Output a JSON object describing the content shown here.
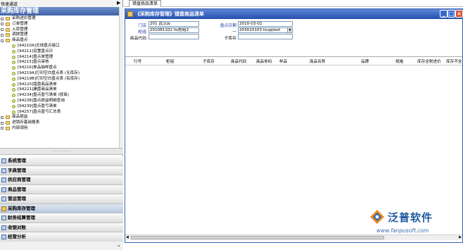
{
  "quick_channel": "快速通道",
  "tabs": [
    {
      "label": "错盘商品清单"
    }
  ],
  "sidebar": {
    "title": "采购库存管理",
    "tree": [
      {
        "label": "采购进价管理",
        "type": "folder",
        "level": 0,
        "expanded": false
      },
      {
        "label": "订单管理",
        "type": "folder",
        "level": 0,
        "expanded": false
      },
      {
        "label": "入库管理",
        "type": "folder",
        "level": 0,
        "expanded": false
      },
      {
        "label": "调拨管理",
        "type": "folder",
        "level": 0,
        "expanded": false
      },
      {
        "label": "商品盘点",
        "type": "folder",
        "level": 0,
        "expanded": true
      },
      {
        "label": "[94210A]无线盘点接口",
        "type": "leaf",
        "level": 1
      },
      {
        "label": "[94211]设置盘点日",
        "type": "leaf",
        "level": 1
      },
      {
        "label": "[94214]盘点单管理",
        "type": "leaf",
        "level": 1
      },
      {
        "label": "[94215]盘点审核",
        "type": "leaf",
        "level": 1
      },
      {
        "label": "[94216]单品抽样盘点",
        "type": "leaf",
        "level": 1
      },
      {
        "label": "[94219A]打印空白盘点表 (无库存)",
        "type": "leaf",
        "level": 1
      },
      {
        "label": "[94219B]打印空白盘点表 (有库存)",
        "type": "leaf",
        "level": 1
      },
      {
        "label": "[94220]错盘商品清单",
        "type": "leaf",
        "level": 1
      },
      {
        "label": "[94221]漏盘商品清单",
        "type": "leaf",
        "level": 1
      },
      {
        "label": "[94234]盘点盈亏清单 (按串)",
        "type": "leaf",
        "level": 1
      },
      {
        "label": "[94238]盘点损益明细查询",
        "type": "leaf",
        "level": 1
      },
      {
        "label": "[94239]盘点盈亏清单",
        "type": "leaf",
        "level": 1
      },
      {
        "label": "[94257]盘点盈亏汇总表",
        "type": "leaf",
        "level": 1
      },
      {
        "label": "商品损益",
        "type": "folder",
        "level": 0,
        "expanded": false
      },
      {
        "label": "进销存基础报表",
        "type": "folder",
        "level": 0,
        "expanded": false
      },
      {
        "label": "内部调用",
        "type": "folder",
        "level": 0,
        "expanded": false
      }
    ],
    "menu": [
      {
        "label": "系统管理",
        "active": false
      },
      {
        "label": "字典管理",
        "active": false
      },
      {
        "label": "供应商管理",
        "active": false
      },
      {
        "label": "商品管理",
        "active": false
      },
      {
        "label": "营运管理",
        "active": false
      },
      {
        "label": "采购库存管理",
        "active": true
      },
      {
        "label": "财务结算管理",
        "active": false
      },
      {
        "label": "收银对账",
        "active": false
      },
      {
        "label": "经营分析",
        "active": false
      }
    ]
  },
  "window": {
    "title": "《采购库存管理》错盘商品清单",
    "buttons": {
      "minimize": "_",
      "restore": "□",
      "close": "×"
    }
  },
  "form": {
    "store_label": "门店",
    "store_value": "201  武汉店",
    "cabinet_label": "柜组",
    "cabinet_value": "201081102  liu柜组2",
    "code_label": "商品代码",
    "code_value": "",
    "date_label": "盘点日期",
    "date_value": "2010-03-02",
    "batch_label": "一",
    "batch_value": "203010103  liuqqtest",
    "sub_label": "子库存",
    "sub_value": ""
  },
  "grid": {
    "columns": [
      "行号",
      "柜组",
      "子库存",
      "商品代码",
      "商品条码",
      "样品",
      "商品名称",
      "品牌",
      "规格",
      "库存含税进价",
      "库存不含"
    ],
    "rows": []
  },
  "logo": {
    "name": "泛普软件",
    "url": "www.fanpusoft.com"
  }
}
